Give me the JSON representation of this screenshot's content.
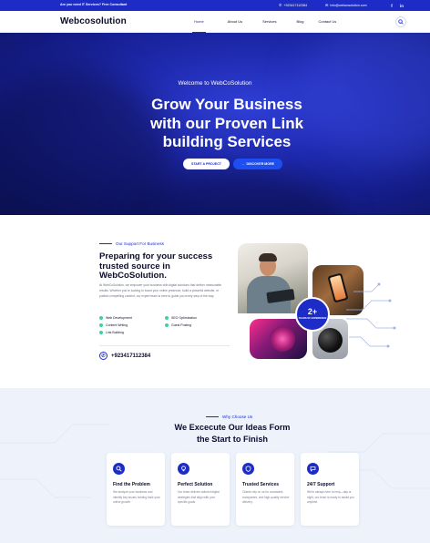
{
  "topbar": {
    "promo": "Are you need IT Services? Free Consultant",
    "phone": "+923417112384",
    "email": "Info@webcosolution.com",
    "social": [
      "f",
      "in"
    ]
  },
  "nav": {
    "logo": "Webcosolution",
    "items": [
      "Home",
      "About Us",
      "Services",
      "Blog",
      "Contact Us"
    ],
    "active": "Home"
  },
  "hero": {
    "welcome": "Welcome to WebCoSolution",
    "title_lines": [
      "Grow Your Business",
      "with our Proven Link",
      "building Services"
    ],
    "primary_button": "START A PROJECT",
    "secondary_button": "DISCOVER MORE"
  },
  "about": {
    "eyebrow": "Our Support For Business",
    "title_lines": [
      "Preparing for your success",
      "trusted source in",
      "WebCoSolution."
    ],
    "paragraph": "At WebCoSolution, we empower your business with digital solutions that deliver measurable results. Whether you're looking to boost your online presence, build a powerful website, or publish compelling content, our expert team is here to guide you every step of the way.",
    "features": [
      "Web Development",
      "SEO Optimization",
      "Content Writing",
      "Guest Posting",
      "Link Building"
    ],
    "phone": "+923417112384",
    "badge_number": "2+",
    "badge_label": "YEARS OF EXPERIENCE"
  },
  "why": {
    "eyebrow": "Why Choose Us",
    "title_lines": [
      "We Excecute Our Ideas Form",
      "the Start to Finish"
    ],
    "cards": [
      {
        "title": "Find the Problem",
        "text": "We analyze your business and identify key issues holding back your online growth.",
        "icon": "search-icon"
      },
      {
        "title": "Perfect Solution",
        "text": "Our team delivers tailored digital strategies that align with your specific goals.",
        "icon": "lightbulb-icon"
      },
      {
        "title": "Trusted Services",
        "text": "Clients rely on us for consistent, transparent, and high-quality service delivery.",
        "icon": "shield-icon"
      },
      {
        "title": "24/7 Support",
        "text": "We're always here to help—day or night, our team is ready to assist you anytime.",
        "icon": "chat-icon"
      }
    ]
  },
  "colors": {
    "primary": "#1d2cc7",
    "accent_blue": "#1d4ff0",
    "check_green": "#3ad29f",
    "dark_text": "#0b0d2c",
    "section_bg": "#eef3fb"
  }
}
